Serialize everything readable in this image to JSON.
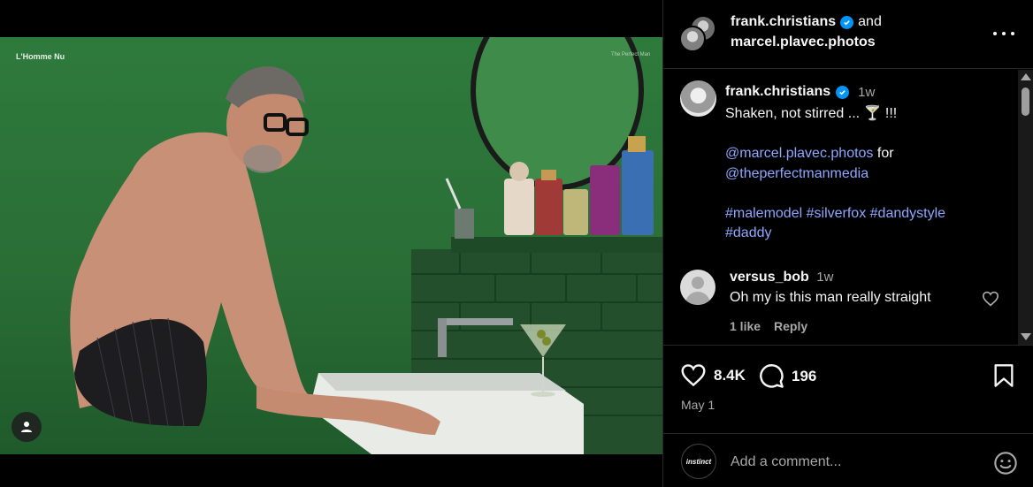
{
  "media": {
    "overlay_left": "L'Homme Nu",
    "overlay_right": "The Perfect Man"
  },
  "header": {
    "user1": "frank.christians",
    "and_text": "and",
    "user2": "marcel.plavec.photos"
  },
  "caption": {
    "username": "frank.christians",
    "time": "1w",
    "text_line1": "Shaken, not stirred ... 🍸 !!!",
    "mention1": "@marcel.plavec.photos",
    "for_text": "for",
    "mention2": "@theperfectmanmedia",
    "hashtag1": "#malemodel",
    "hashtag2": "#silverfox",
    "hashtag3": "#dandystyle",
    "hashtag4": "#daddy"
  },
  "comment": {
    "username": "versus_bob",
    "time": "1w",
    "text": "Oh my is this man really straight",
    "likes": "1 like",
    "reply": "Reply"
  },
  "actions": {
    "likes_count": "8.4K",
    "comments_count": "196",
    "date": "May 1"
  },
  "add_comment": {
    "avatar_label": "instinct",
    "placeholder": "Add a comment..."
  },
  "colors": {
    "background": "#000000",
    "link": "#8ea7ff",
    "verified": "#0095f6",
    "muted": "#a8a8a8"
  }
}
